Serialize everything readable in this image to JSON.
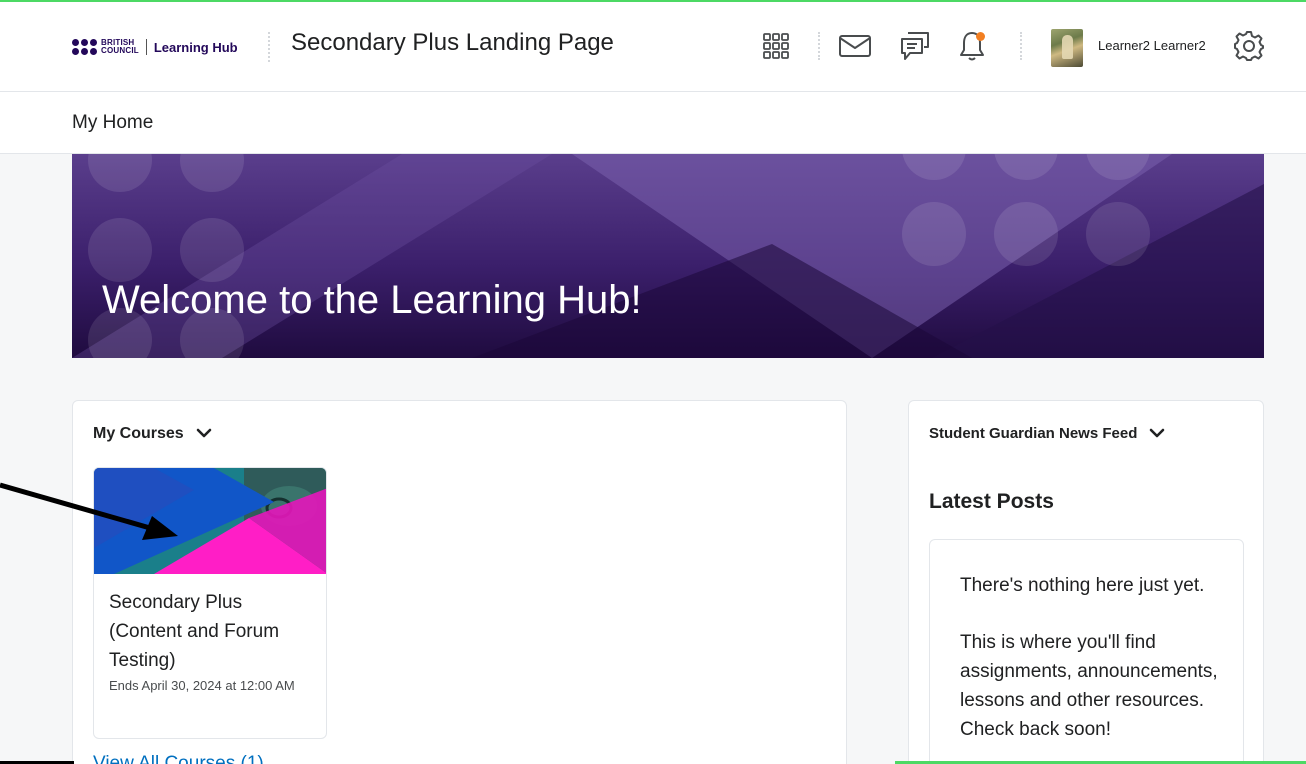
{
  "header": {
    "brand_line1": "BRITISH",
    "brand_line2": "COUNCIL",
    "brand_hub": "Learning Hub",
    "page_title": "Secondary Plus Landing Page",
    "icons": [
      "grid-icon",
      "mail-icon",
      "chat-icon",
      "bell-icon",
      "gear-icon"
    ],
    "notification_color": "#f27f22",
    "user_name": "Learner2 Learner2"
  },
  "nav": {
    "items": [
      {
        "label": "My Home"
      }
    ]
  },
  "banner": {
    "title": "Welcome to the Learning Hub!"
  },
  "my_courses": {
    "title": "My Courses",
    "courses": [
      {
        "name": "Secondary Plus (Content and Forum Testing)",
        "ends": "Ends April 30, 2024 at 12:00 AM"
      }
    ],
    "view_all": "View All Courses (1)"
  },
  "news_feed": {
    "title": "Student Guardian News Feed",
    "latest_posts": "Latest Posts",
    "empty_message": "There's nothing here just yet.",
    "description": "This is where you'll find assignments, announcements, lessons and other resources. Check back soon!"
  },
  "colors": {
    "accent_link": "#006fbf",
    "brand_navy": "#23085a",
    "annotation_green": "#4cd964"
  }
}
